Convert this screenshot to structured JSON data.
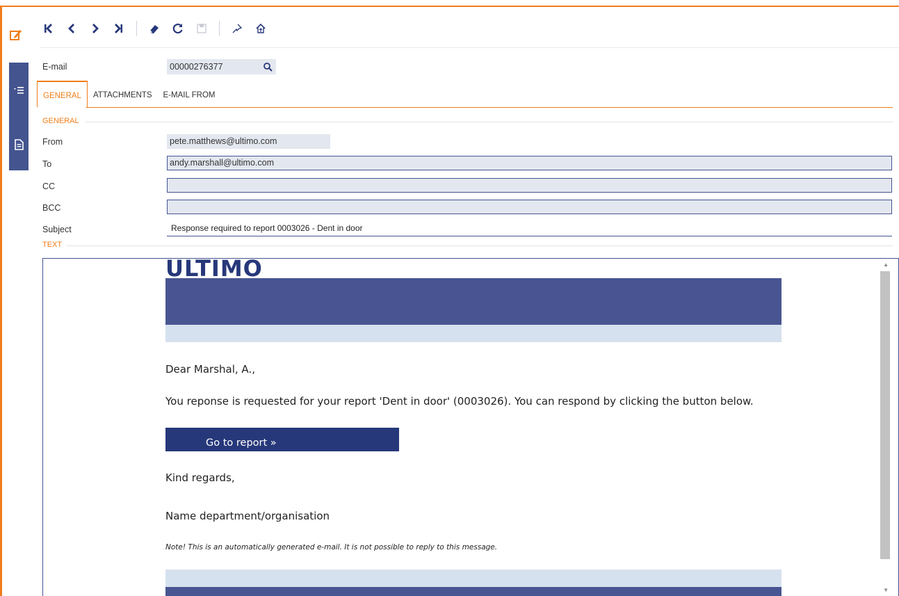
{
  "toolbar": {
    "icons": [
      "first-record-icon",
      "previous-record-icon",
      "next-record-icon",
      "last-record-icon",
      "eraser-icon",
      "refresh-icon",
      "save-icon",
      "pin-icon",
      "home-icon"
    ]
  },
  "record": {
    "key_label": "E-mail",
    "key_value": "00000276377"
  },
  "tabs": [
    {
      "label": "GENERAL",
      "active": true
    },
    {
      "label": "ATTACHMENTS",
      "active": false
    },
    {
      "label": "E-MAIL FROM",
      "active": false
    }
  ],
  "sections": {
    "general": "GENERAL",
    "text": "TEXT"
  },
  "fields": {
    "from_label": "From",
    "from_value": "pete.matthews@ultimo.com",
    "to_label": "To",
    "to_value": "andy.marshall@ultimo.com",
    "cc_label": "CC",
    "cc_value": "",
    "bcc_label": "BCC",
    "bcc_value": "",
    "subject_label": "Subject",
    "subject_value": "Response required to report 0003026 - Dent in door"
  },
  "email_body": {
    "logo": "ULTIMO",
    "greeting": "Dear Marshal, A.,",
    "message": "You reponse is requested for your report 'Dent in door' (0003026). You can respond by clicking the button below.",
    "button": "Go to report »",
    "closing": "Kind regards,",
    "signature": "Name department/organisation",
    "note": "Note! This is an automatically generated e-mail. It is not possible to reply to this message."
  },
  "colors": {
    "accent": "#f07d1a",
    "brand": "#27387a",
    "banner": "#485592",
    "band": "#d6e1ef",
    "field_bg": "#e3e7ef"
  }
}
